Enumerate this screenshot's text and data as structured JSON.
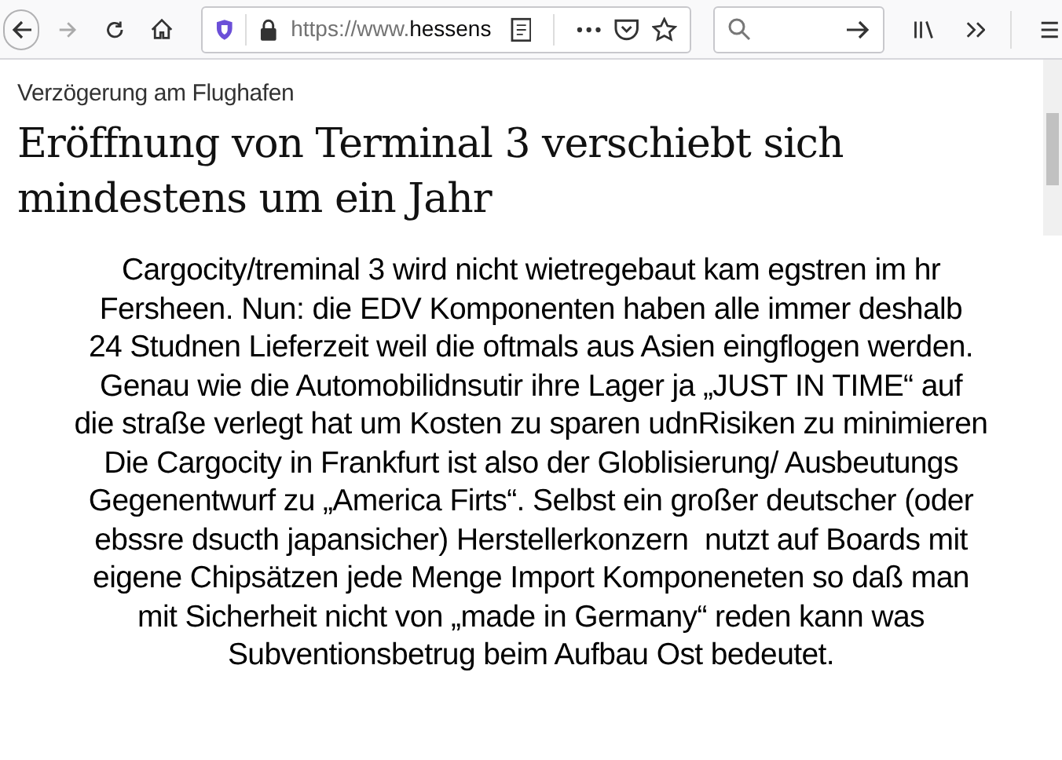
{
  "toolbar": {
    "url_scheme": "https://www.",
    "url_host": "hessens"
  },
  "article": {
    "kicker": "Verzögerung am Flughafen",
    "headline_lines": [
      "Eröffnung von Terminal 3 verschiebt sich",
      "mindestens um ein Jahr"
    ]
  },
  "comment_lines": [
    "Cargocity/treminal 3 wird nicht wietregebaut kam egstren im hr",
    "Fersheen. Nun: die EDV Komponenten haben alle immer deshalb",
    "24 Studnen Lieferzeit weil die oftmals aus Asien eingflogen werden.",
    "Genau wie die Automobilidnsutir ihre Lager ja „JUST IN TIME“ auf",
    "die straße verlegt hat um Kosten zu sparen udnRisiken zu minimieren",
    "Die Cargocity in Frankfurt ist also der Globlisierung/ Ausbeutungs",
    "Gegenentwurf zu „America Firts“. Selbst ein großer deutscher (oder",
    "ebssre dsucth japansicher) Herstellerkonzern  nutzt auf Boards mit",
    "eigene Chipsätzen jede Menge Import Komponeneten so daß man",
    "mit Sicherheit nicht von „made in Germany“ reden kann was",
    "Subventionsbetrug beim Aufbau Ost bedeutet."
  ]
}
